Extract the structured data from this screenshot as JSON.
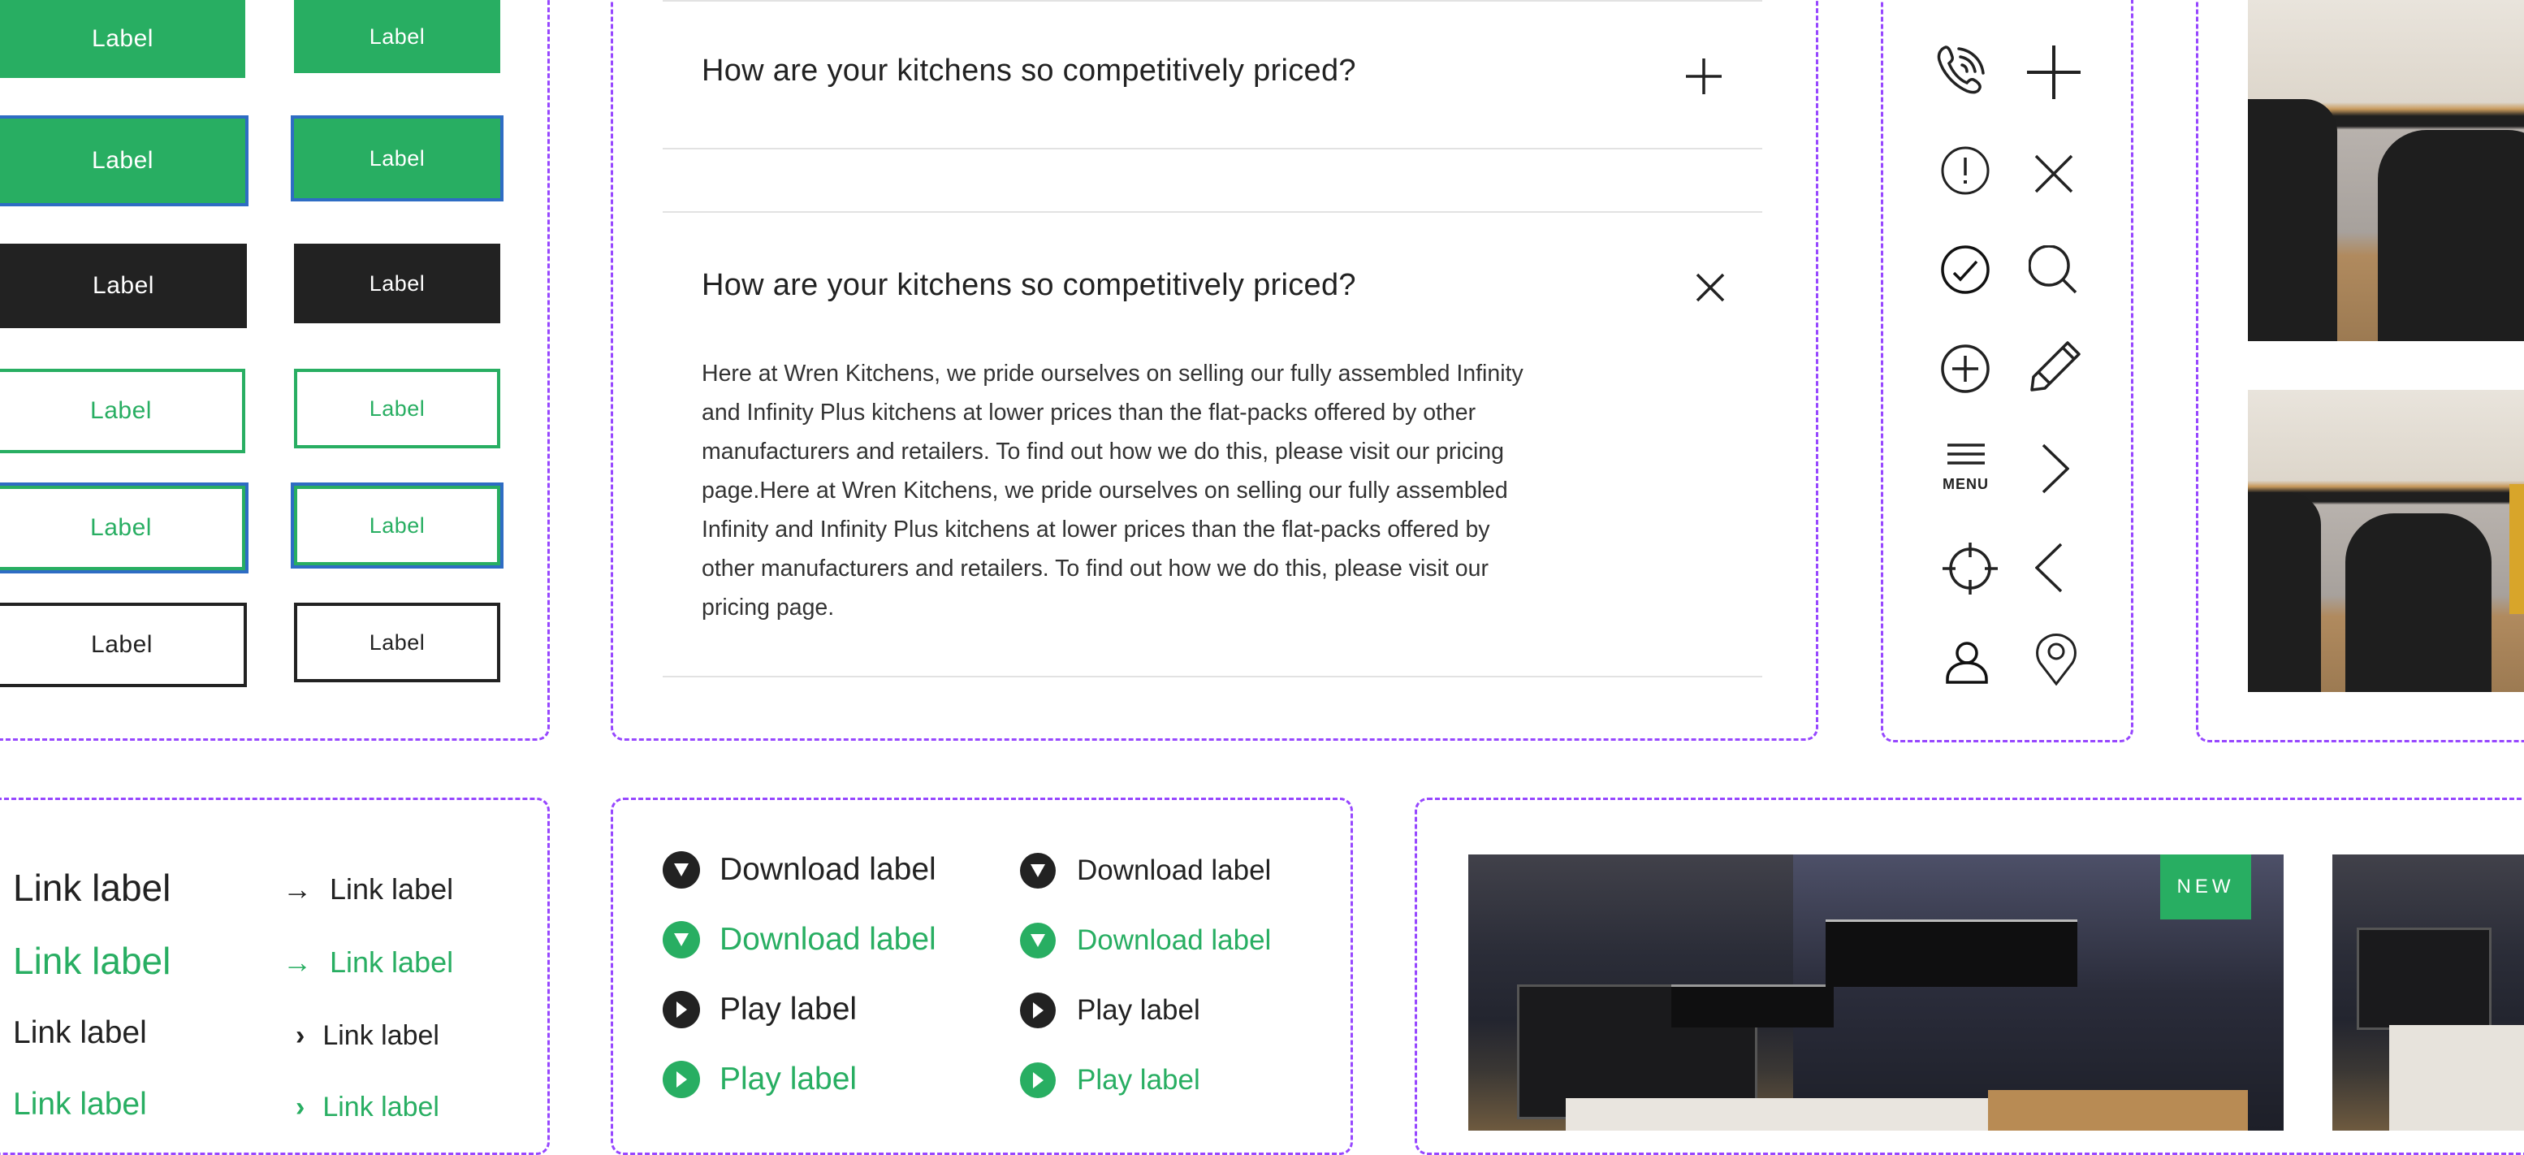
{
  "colors": {
    "accent": "#28ae62",
    "dark": "#222222",
    "focus": "#2e6cc4",
    "guide": "#9747ff",
    "divider": "#e2e2e2"
  },
  "buttons": {
    "large": [
      {
        "label": "Label",
        "variant": "primary"
      },
      {
        "label": "Label",
        "variant": "primary-focus"
      },
      {
        "label": "Label",
        "variant": "dark"
      },
      {
        "label": "Label",
        "variant": "outline-green"
      },
      {
        "label": "Label",
        "variant": "outline-green-focus"
      },
      {
        "label": "Label",
        "variant": "outline-dark"
      }
    ],
    "small": [
      {
        "label": "Label",
        "variant": "primary"
      },
      {
        "label": "Label",
        "variant": "primary-focus"
      },
      {
        "label": "Label",
        "variant": "dark"
      },
      {
        "label": "Label",
        "variant": "outline-green"
      },
      {
        "label": "Label",
        "variant": "outline-green-focus"
      },
      {
        "label": "Label",
        "variant": "outline-dark"
      }
    ]
  },
  "faq": {
    "items": [
      {
        "question": "How are your kitchens so competitively priced?",
        "state": "collapsed",
        "toggle_icon": "plus-icon"
      },
      {
        "question": "How are your kitchens so competitively priced?",
        "state": "expanded",
        "toggle_icon": "close-icon",
        "answer": "Here at Wren Kitchens, we pride ourselves on selling our fully assembled Infinity and Infinity Plus kitchens at lower prices than the flat-packs offered by other manufacturers and retailers. To find out how we do this, please visit our pricing page.Here at Wren Kitchens, we pride ourselves on selling our fully assembled Infinity and Infinity Plus kitchens at lower prices than the flat-packs offered by other manufacturers and retailers. To find out how we do this, please visit our pricing page."
      }
    ]
  },
  "icons": {
    "grid": [
      "phone-icon",
      "plus-icon",
      "alert-circle-icon",
      "close-icon",
      "check-circle-icon",
      "search-icon",
      "plus-circle-icon",
      "pencil-icon",
      "menu-icon",
      "chevron-right-icon",
      "crosshair-icon",
      "chevron-left-icon",
      "user-icon",
      "location-pin-icon"
    ],
    "menu_label": "MENU"
  },
  "gallery": {
    "images": [
      {
        "alt": "Light grey gloss kitchen with oak worktop and dark chairs"
      },
      {
        "alt": "Light grey gloss kitchen island with yellow stool"
      }
    ]
  },
  "links": {
    "items": [
      {
        "label": "Link label",
        "color": "black",
        "size": "large"
      },
      {
        "label": "Link label",
        "color": "green",
        "size": "large"
      },
      {
        "label": "Link label",
        "color": "black",
        "size": "medium"
      },
      {
        "label": "Link label",
        "color": "green",
        "size": "medium"
      }
    ],
    "arrow_items": [
      {
        "label": "Link label",
        "color": "black",
        "icon": "arrow-right-icon",
        "glyph": "→"
      },
      {
        "label": "Link label",
        "color": "green",
        "icon": "arrow-right-icon",
        "glyph": "→"
      },
      {
        "label": "Link label",
        "color": "black",
        "icon": "chevron-right-icon",
        "glyph": "›"
      },
      {
        "label": "Link label",
        "color": "green",
        "icon": "chevron-right-icon",
        "glyph": "›"
      }
    ]
  },
  "media_links": {
    "large": [
      {
        "label": "Download label",
        "color": "black",
        "icon": "download-icon"
      },
      {
        "label": "Download label",
        "color": "green",
        "icon": "download-icon"
      },
      {
        "label": "Play label",
        "color": "black",
        "icon": "play-icon"
      },
      {
        "label": "Play label",
        "color": "green",
        "icon": "play-icon"
      }
    ],
    "small": [
      {
        "label": "Download label",
        "color": "black",
        "icon": "download-icon"
      },
      {
        "label": "Download label",
        "color": "green",
        "icon": "download-icon"
      },
      {
        "label": "Play label",
        "color": "black",
        "icon": "play-icon"
      },
      {
        "label": "Play label",
        "color": "green",
        "icon": "play-icon"
      }
    ]
  },
  "cards": {
    "items": [
      {
        "badge": "NEW",
        "alt": "Dark modern kitchen at night with city view"
      },
      {
        "alt": "Dark kitchen with white island"
      }
    ]
  }
}
